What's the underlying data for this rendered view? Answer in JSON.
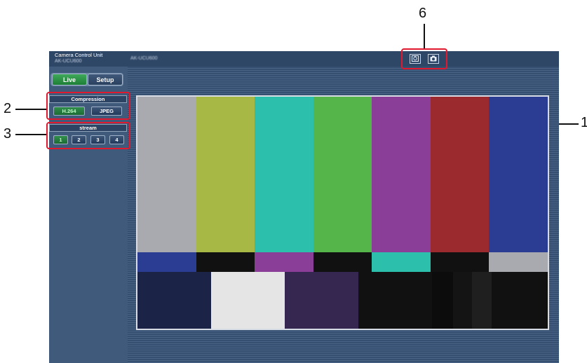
{
  "callouts": [
    "1",
    "2",
    "3",
    "6"
  ],
  "app": {
    "title": "Camera Control Unit",
    "model": "AK-UCU600",
    "header_model": "AK-UCU600"
  },
  "tabs": [
    {
      "label": "Live",
      "active": true
    },
    {
      "label": "Setup",
      "active": false
    }
  ],
  "compression": {
    "header": "Compression",
    "options": [
      {
        "label": "H.264",
        "selected": true
      },
      {
        "label": "JPEG",
        "selected": false
      }
    ]
  },
  "stream": {
    "header": "stream",
    "options": [
      {
        "label": "1",
        "selected": true
      },
      {
        "label": "2",
        "selected": false
      },
      {
        "label": "3",
        "selected": false
      },
      {
        "label": "4",
        "selected": false
      }
    ]
  },
  "toolbar_icons": [
    "snapshot-settings-icon",
    "camera-icon"
  ],
  "colors": {
    "accent_green": "#1d7f36",
    "panel_blue": "#3f5a7b",
    "callout_red": "#e0192e"
  },
  "color_bars": {
    "top": [
      "#a9aab0",
      "#a8b845",
      "#2cbfac",
      "#55b54a",
      "#8a3e98",
      "#9a2a2d",
      "#2a3d92"
    ],
    "middle": [
      "#2a3d92",
      "#111111",
      "#8a3e98",
      "#111111",
      "#2cbfac",
      "#111111",
      "#a9aab0"
    ],
    "bottom": [
      "#1b2347",
      "#e5e5e5",
      "#35274f",
      "#111111",
      "#0c0c0c",
      "#141414",
      "#1f1f1f",
      "#111111"
    ]
  }
}
